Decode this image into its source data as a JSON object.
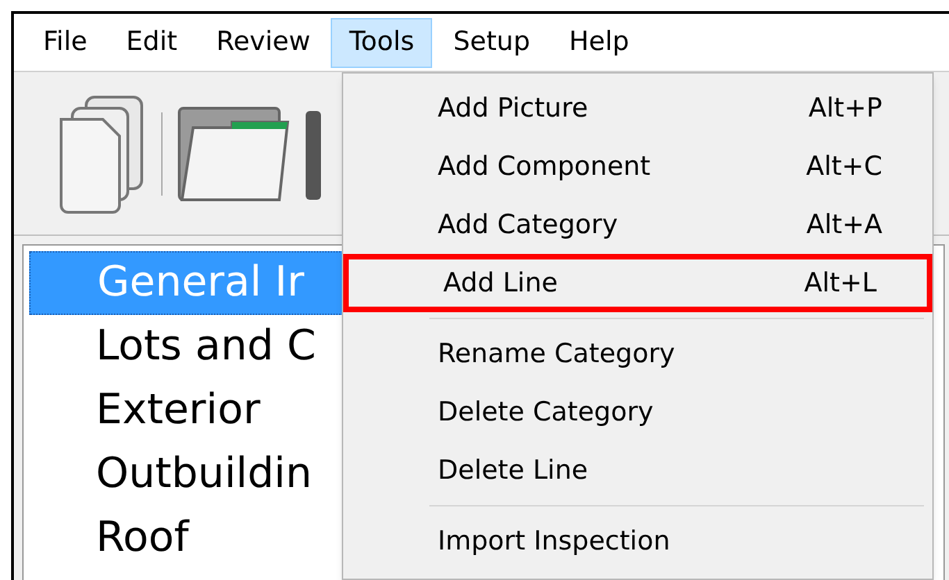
{
  "menu_bar": [
    {
      "label": "File",
      "selected": false
    },
    {
      "label": "Edit",
      "selected": false
    },
    {
      "label": "Review",
      "selected": false
    },
    {
      "label": "Tools",
      "selected": true
    },
    {
      "label": "Setup",
      "selected": false
    },
    {
      "label": "Help",
      "selected": false
    }
  ],
  "tree": {
    "items": [
      {
        "label": "General Ir",
        "selected": true
      },
      {
        "label": "Lots and C",
        "selected": false
      },
      {
        "label": "Exterior",
        "selected": false
      },
      {
        "label": "Outbuildin",
        "selected": false
      },
      {
        "label": "Roof",
        "selected": false
      }
    ]
  },
  "tools_menu": {
    "items": [
      {
        "kind": "item",
        "label": "Add Picture",
        "shortcut": "Alt+P",
        "highlighted": false
      },
      {
        "kind": "item",
        "label": "Add Component",
        "shortcut": "Alt+C",
        "highlighted": false
      },
      {
        "kind": "item",
        "label": "Add Category",
        "shortcut": "Alt+A",
        "highlighted": false
      },
      {
        "kind": "item",
        "label": "Add Line",
        "shortcut": "Alt+L",
        "highlighted": true
      },
      {
        "kind": "separator"
      },
      {
        "kind": "item",
        "label": "Rename Category",
        "highlighted": false
      },
      {
        "kind": "item",
        "label": "Delete Category",
        "highlighted": false
      },
      {
        "kind": "item",
        "label": "Delete Line",
        "highlighted": false
      },
      {
        "kind": "separator"
      },
      {
        "kind": "item",
        "label": "Import Inspection",
        "highlighted": false
      }
    ]
  }
}
